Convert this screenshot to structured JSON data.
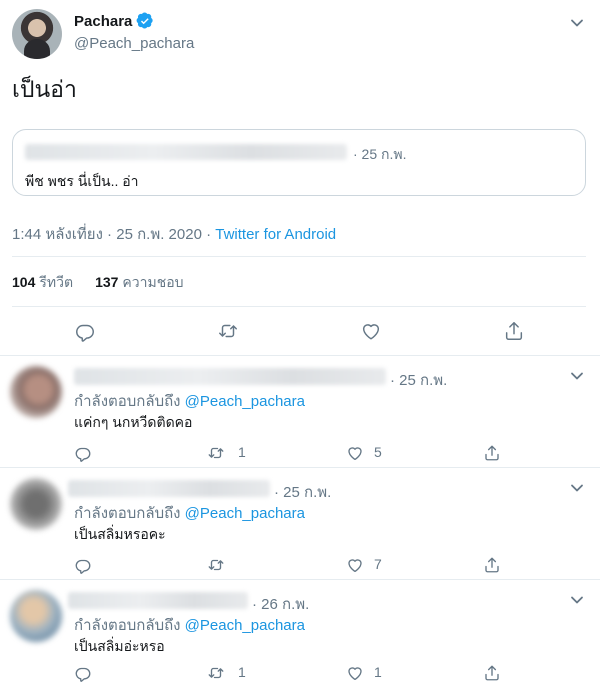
{
  "tweet": {
    "author_name": "Pachara",
    "author_handle": "@Peach_pachara",
    "text": "เป็นอ่า",
    "quote": {
      "date": "· 25 ก.พ.",
      "text": "พีช พชร นี่เป็น.. อ่า"
    },
    "time": "1:44 หลังเที่ยง · 25 ก.พ. 2020 · ",
    "source": "Twitter for Android",
    "stats": {
      "retweets_count": "104",
      "retweets_label": "รีทวีต",
      "likes_count": "137",
      "likes_label": "ความชอบ"
    }
  },
  "replies": [
    {
      "date": "· 25 ก.พ.",
      "replying_to_label": "กำลังตอบกลับถึง",
      "mention": "@Peach_pachara",
      "text": "แค่กๆ นกหวีดติดคอ",
      "retweets": "1",
      "likes": "5"
    },
    {
      "date": "· 25 ก.พ.",
      "replying_to_label": "กำลังตอบกลับถึง",
      "mention": "@Peach_pachara",
      "text": "เป็นสลิ่มหรอคะ",
      "retweets": "",
      "likes": "7"
    },
    {
      "date": "· 26 ก.พ.",
      "replying_to_label": "กำลังตอบกลับถึง",
      "mention": "@Peach_pachara",
      "text": "เป็นสลิ่มอ่ะหรอ",
      "retweets": "1",
      "likes": "1"
    }
  ],
  "colors": {
    "accent": "#1da1f2",
    "link": "#1b95e0",
    "muted": "#657786",
    "text": "#14171a",
    "border": "#e6ecf0"
  },
  "icons": [
    "verified-badge-icon",
    "chevron-down-icon",
    "reply-icon",
    "retweet-icon",
    "like-icon",
    "share-icon"
  ]
}
